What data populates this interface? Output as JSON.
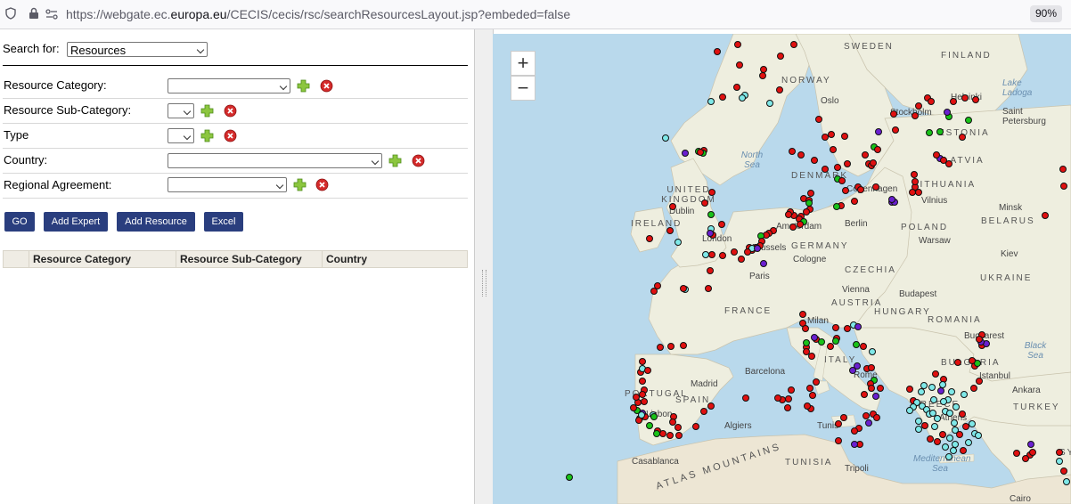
{
  "browser": {
    "url_prefix": "https://webgate.ec.",
    "url_domain": "europa.eu",
    "url_suffix": "/CECIS/cecis/rsc/searchResourcesLayout.jsp?embeded=false",
    "zoom": "90%"
  },
  "search": {
    "label": "Search for:",
    "value": "Resources"
  },
  "filters": [
    {
      "label": "Resource Category:",
      "value": ""
    },
    {
      "label": "Resource Sub-Category:",
      "value": ""
    },
    {
      "label": "Type",
      "value": ""
    },
    {
      "label": "Country:",
      "value": ""
    },
    {
      "label": "Regional Agreement:",
      "value": ""
    }
  ],
  "buttons": {
    "go": "GO",
    "add_expert": "Add Expert",
    "add_resource": "Add Resource",
    "excel": "Excel"
  },
  "table": {
    "columns": [
      "Resource Category",
      "Resource Sub-Category",
      "Country"
    ],
    "rows": []
  },
  "map": {
    "zoom_in": "+",
    "zoom_out": "−",
    "labels": {
      "sweden": "SWEDEN",
      "finland": "FINLAND",
      "norway": "NORWAY",
      "oslo": "Oslo",
      "helsinki": "Helsinki",
      "saint_petersburg": "Saint Petersburg",
      "stockholm": "Stockholm",
      "ladoga": "Lake Ladoga",
      "estonia": "ESTONIA",
      "latvia": "LATVIA",
      "north_sea": "North Sea",
      "denmark": "DENMARK",
      "copenhagen": "Copenhagen",
      "lithuania": "LITHUANIA",
      "vilnius": "Vilnius",
      "minsk": "Minsk",
      "belarus": "BELARUS",
      "united_kingdom": "UNITED KINGDOM",
      "dublin": "Dublin",
      "ireland": "IRELAND",
      "london": "London",
      "amsterdam": "Amsterdam",
      "germany": "GERMANY",
      "berlin": "Berlin",
      "poland": "POLAND",
      "warsaw": "Warsaw",
      "brussels": "Brussels",
      "cologne": "Cologne",
      "czechia": "CZECHIA",
      "kiev": "Kiev",
      "ukraine": "UKRAINE",
      "paris": "Paris",
      "vienna": "Vienna",
      "budapest": "Budapest",
      "france": "FRANCE",
      "austria": "AUSTRIA",
      "hungary": "HUNGARY",
      "milan": "Milan",
      "romania": "ROMANIA",
      "bucharest": "Bucharest",
      "black_sea": "Black Sea",
      "barcelona": "Barcelona",
      "italy": "ITALY",
      "bulgaria": "BULGARIA",
      "rome": "Rome",
      "istanbul": "Istanbul",
      "portugal": "PORTUGAL",
      "madrid": "Madrid",
      "spain": "SPAIN",
      "ankara": "Ankara",
      "greece": "GREECE",
      "turkey": "TURKEY",
      "athens": "Athens",
      "lisbon": "Lisbon",
      "algiers": "Algiers",
      "tunis": "Tunis",
      "mediterranean": "Mediterranean Sea",
      "casablanca": "Casablanca",
      "tunisia": "TUNISIA",
      "tripoli": "Tripoli",
      "atlas": "ATLAS MOUNTAINS",
      "cairo": "Cairo",
      "syria": "SY"
    }
  },
  "colors": {
    "button_bg": "#2a3e7e",
    "marker_red": "#e01010",
    "marker_green": "#19c219",
    "marker_purple": "#6a1fd0",
    "marker_cyan": "#7fe8e8",
    "sea": "#b9d9ec",
    "land": "#eeeedf"
  }
}
